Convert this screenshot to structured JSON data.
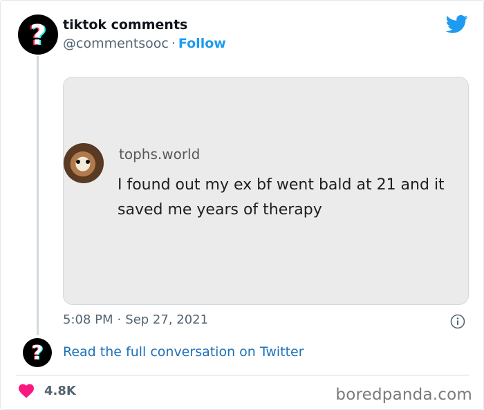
{
  "tweet": {
    "author_name": "tiktok comments",
    "author_handle": "@commentsooc",
    "separator": "·",
    "follow_label": "Follow",
    "avatar_icon": "tiktok-question-icon",
    "platform_icon": "twitter-bird-icon",
    "accent_color": "#1d9bf0"
  },
  "media": {
    "username": "tophs.world",
    "comment_text": "I found out my ex bf went bald at 21 and it saved me years of therapy"
  },
  "meta": {
    "time": "5:08 PM",
    "separator": "·",
    "date": "Sep 27, 2021",
    "info_icon": "info-icon"
  },
  "conversation": {
    "read_link": "Read the full conversation on Twitter"
  },
  "engagement": {
    "heart_icon": "heart-icon",
    "like_count": "4.8K",
    "heart_color": "#f91880"
  },
  "watermark": "boredpanda.com"
}
